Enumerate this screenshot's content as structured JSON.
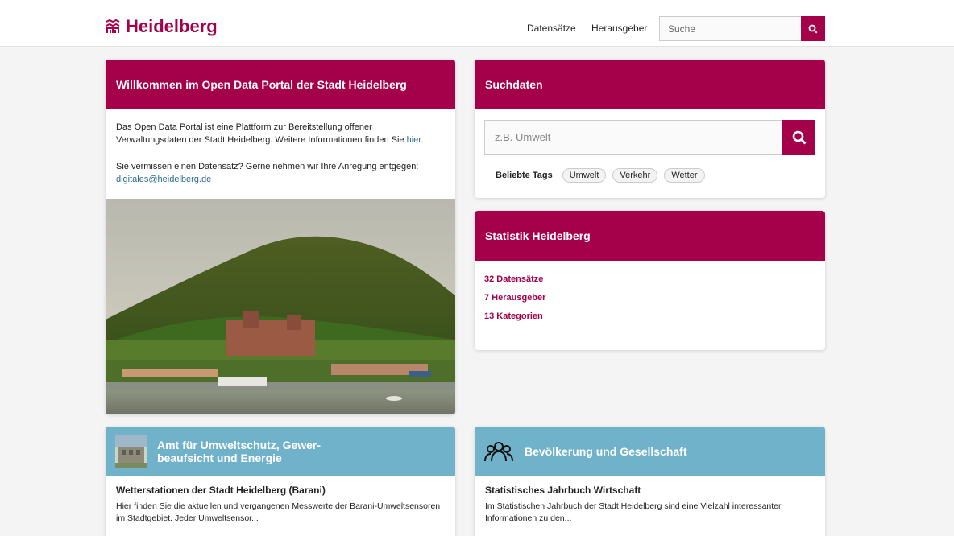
{
  "header": {
    "logo_text": "Heidelberg",
    "nav": [
      "Datensätze",
      "Herausgeber"
    ],
    "search_placeholder": "Suche"
  },
  "welcome": {
    "title": "Willkommen im Open Data Portal der Stadt Heidelberg",
    "para1_text": "Das Open Data Portal ist eine Plattform zur Bereitstellung offener Verwaltungsdaten der Stadt Heidelberg. Weitere Informationen finden Sie ",
    "para1_link": "hier",
    "para1_end": ".",
    "para2_text": "Sie vermissen einen Datensatz? Gerne nehmen wir Ihre Anregung entgegen: ",
    "para2_link": "digitales@heidelberg.de"
  },
  "search_card": {
    "title": "Suchdaten",
    "placeholder": "z.B. Umwelt",
    "tags_label": "Beliebte Tags",
    "tags": [
      "Umwelt",
      "Verkehr",
      "Wetter"
    ]
  },
  "stats": {
    "title": "Statistik Heidelberg",
    "items": [
      "32 Datensätze",
      "7 Herausgeber",
      "13 Kategorien"
    ]
  },
  "categories": [
    {
      "title_line1": "Amt für Umweltschutz, Gewer-",
      "title_line2": "beaufsicht und Energie",
      "dataset_title": "Wetterstationen der Stadt Heidelberg (Barani)",
      "dataset_desc": "Hier finden Sie die aktuellen und vergangenen Messwerte der Barani-Umweltsensoren im Stadtgebiet. Jeder Umweltsensor..."
    },
    {
      "title_line1": "Bevölkerung und Gesellschaft",
      "dataset_title": "Statistisches Jahrbuch Wirtschaft",
      "dataset_desc": "Im Statistischen Jahrbuch der Stadt Heidelberg sind eine Vielzahl interessanter Informationen zu den..."
    }
  ],
  "colors": {
    "brand": "#a5004a",
    "category_blue": "#6fb2c9",
    "link_blue": "#2a6b8f",
    "background": "#f4f4f4"
  }
}
